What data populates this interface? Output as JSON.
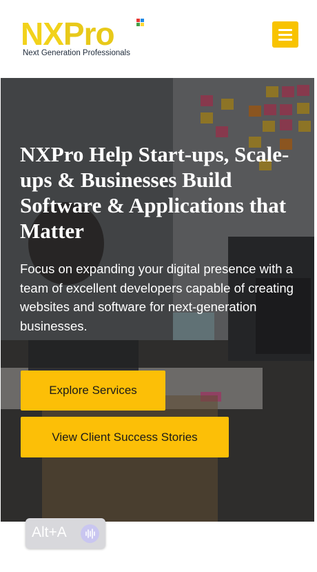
{
  "brand": {
    "logo_nx": "NX",
    "logo_x": "",
    "logo_pro": "Pro",
    "tagline": "Next Generation Professionals",
    "colors": {
      "accent": "#fcbf07",
      "menu_button": "#f8c300",
      "logo_yellow": "#f2d21b",
      "logo_red": "#d43b3b",
      "squares": [
        "#e53935",
        "#1e88e5",
        "#43a047",
        "#fdd835"
      ]
    }
  },
  "header": {
    "menu_icon": "hamburger-icon"
  },
  "hero": {
    "title": "NXPro Help Start-ups, Scale-ups & Businesses Build Software & Applications that Matter",
    "text": "Focus on expanding your digital presence with a team of excellent developers capable of creating websites and software for next-generation businesses.",
    "buttons": {
      "explore": "Explore Services",
      "stories": "View Client Success Stories"
    }
  },
  "overlay_widget": {
    "label": "Alt+A",
    "icon": "waveform-icon"
  }
}
